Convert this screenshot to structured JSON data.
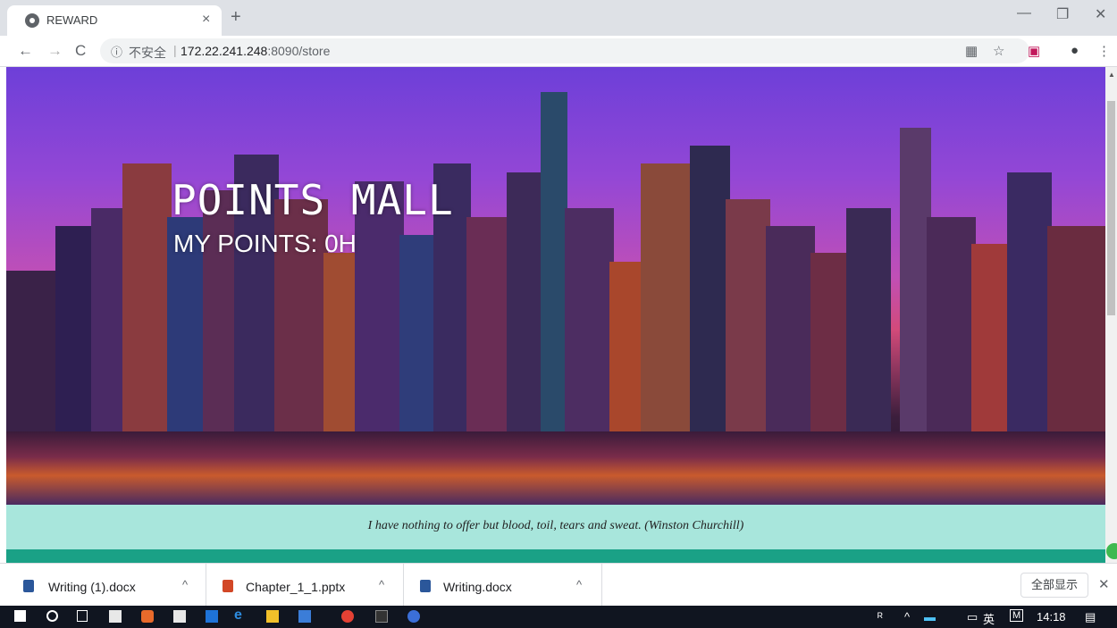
{
  "browser": {
    "tab": {
      "title": "REWARD",
      "close": "×"
    },
    "new_tab": "+",
    "window_controls": {
      "minimize": "—",
      "restore": "❐",
      "close": "✕"
    },
    "nav": {
      "back": "←",
      "forward": "→",
      "reload": "C"
    },
    "address": {
      "info_icon": "ⓘ",
      "security_label": "不安全",
      "separator": "|",
      "host": "172.22.241.248",
      "port_path": ":8090/store"
    },
    "toolbar_icons": {
      "translate": "▦",
      "star": "☆",
      "extension": "▣",
      "account": "●",
      "menu": "⋮"
    }
  },
  "page": {
    "title": "POINTS MALL",
    "points": "MY POINTS: 0H",
    "quote": "I have nothing to offer but blood, toil, tears and sweat. (Winston Churchill)",
    "colors": {
      "quote_bar": "#a8e6dc",
      "teal_bar": "#1aa186"
    }
  },
  "downloads": {
    "items": [
      {
        "name": "Writing (1).docx",
        "icon": "word-doc-icon",
        "color": "#2b579a"
      },
      {
        "name": "Chapter_1_1.pptx",
        "icon": "powerpoint-icon",
        "color": "#d24726"
      },
      {
        "name": "Writing.docx",
        "icon": "word-doc-icon",
        "color": "#2b579a"
      }
    ],
    "caret": "^",
    "show_all": "全部显示",
    "close": "✕"
  },
  "taskbar": {
    "ime": "英",
    "time": "14:18",
    "apps": [
      "windows-start-icon",
      "cortana-icon",
      "task-view-icon",
      "store-icon",
      "office-icon",
      "mail-icon",
      "app-icon",
      "edge-icon",
      "explorer-icon",
      "app-icon",
      "chrome-icon",
      "terminal-icon",
      "app-icon"
    ]
  }
}
